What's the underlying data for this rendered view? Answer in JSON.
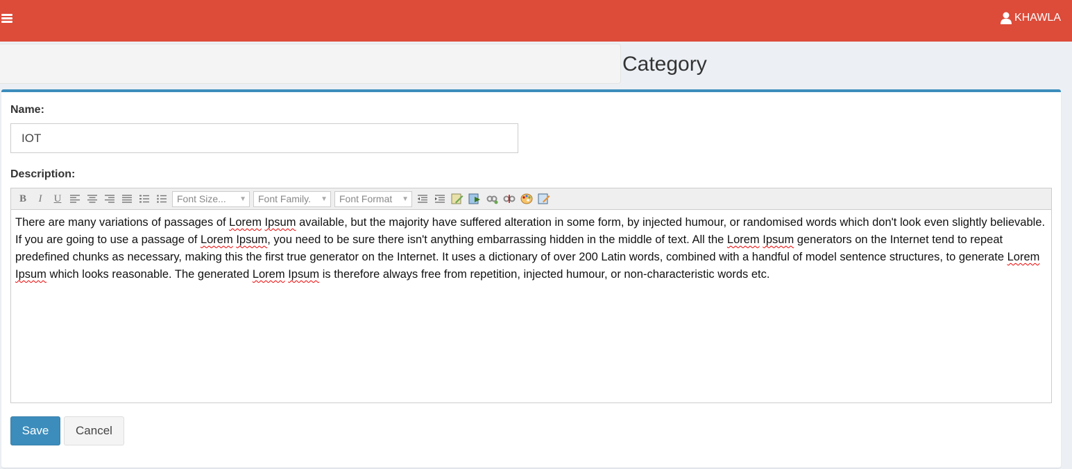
{
  "colors": {
    "topbar": "#dd4b39",
    "accent": "#3c8dbc"
  },
  "topbar": {
    "user_name": "KHAWLA",
    "user_icon": "user-icon",
    "menu_icon": "hamburger-icon"
  },
  "page": {
    "title": "Category"
  },
  "form": {
    "name_label": "Name:",
    "name_value": "IOT",
    "description_label": "Description:",
    "toolbar": {
      "font_size": "Font Size...",
      "font_family": "Font Family.",
      "font_format": "Font Format"
    },
    "description": {
      "p1": "There are many variations of passages of ",
      "w1": "Lorem",
      "s1": " ",
      "w2": "Ipsum",
      "p2": " available, but the majority have suffered alteration in some form, by injected humour, or randomised words which don't look even slightly believable. If you are going to use a passage of ",
      "w3": "Lorem",
      "s2": " ",
      "w4": "Ipsum",
      "p3": ", you need to be sure there isn't anything embarrassing hidden in the middle of text. All the ",
      "w5": "Lorem",
      "s3": " ",
      "w6": "Ipsum",
      "p4": " generators on the Internet tend to repeat predefined chunks as necessary, making this the first true generator on the Internet. It uses a dictionary of over 200 Latin words, combined with a handful of model sentence structures, to generate ",
      "w7": "Lorem",
      "s4": " ",
      "w8": "Ipsum",
      "p5": " which looks reasonable. The generated ",
      "w9": "Lorem",
      "s5": " ",
      "w10": "Ipsum",
      "p6": " is therefore always free from repetition, injected humour, or non-characteristic words etc."
    },
    "save_label": "Save",
    "cancel_label": "Cancel"
  }
}
